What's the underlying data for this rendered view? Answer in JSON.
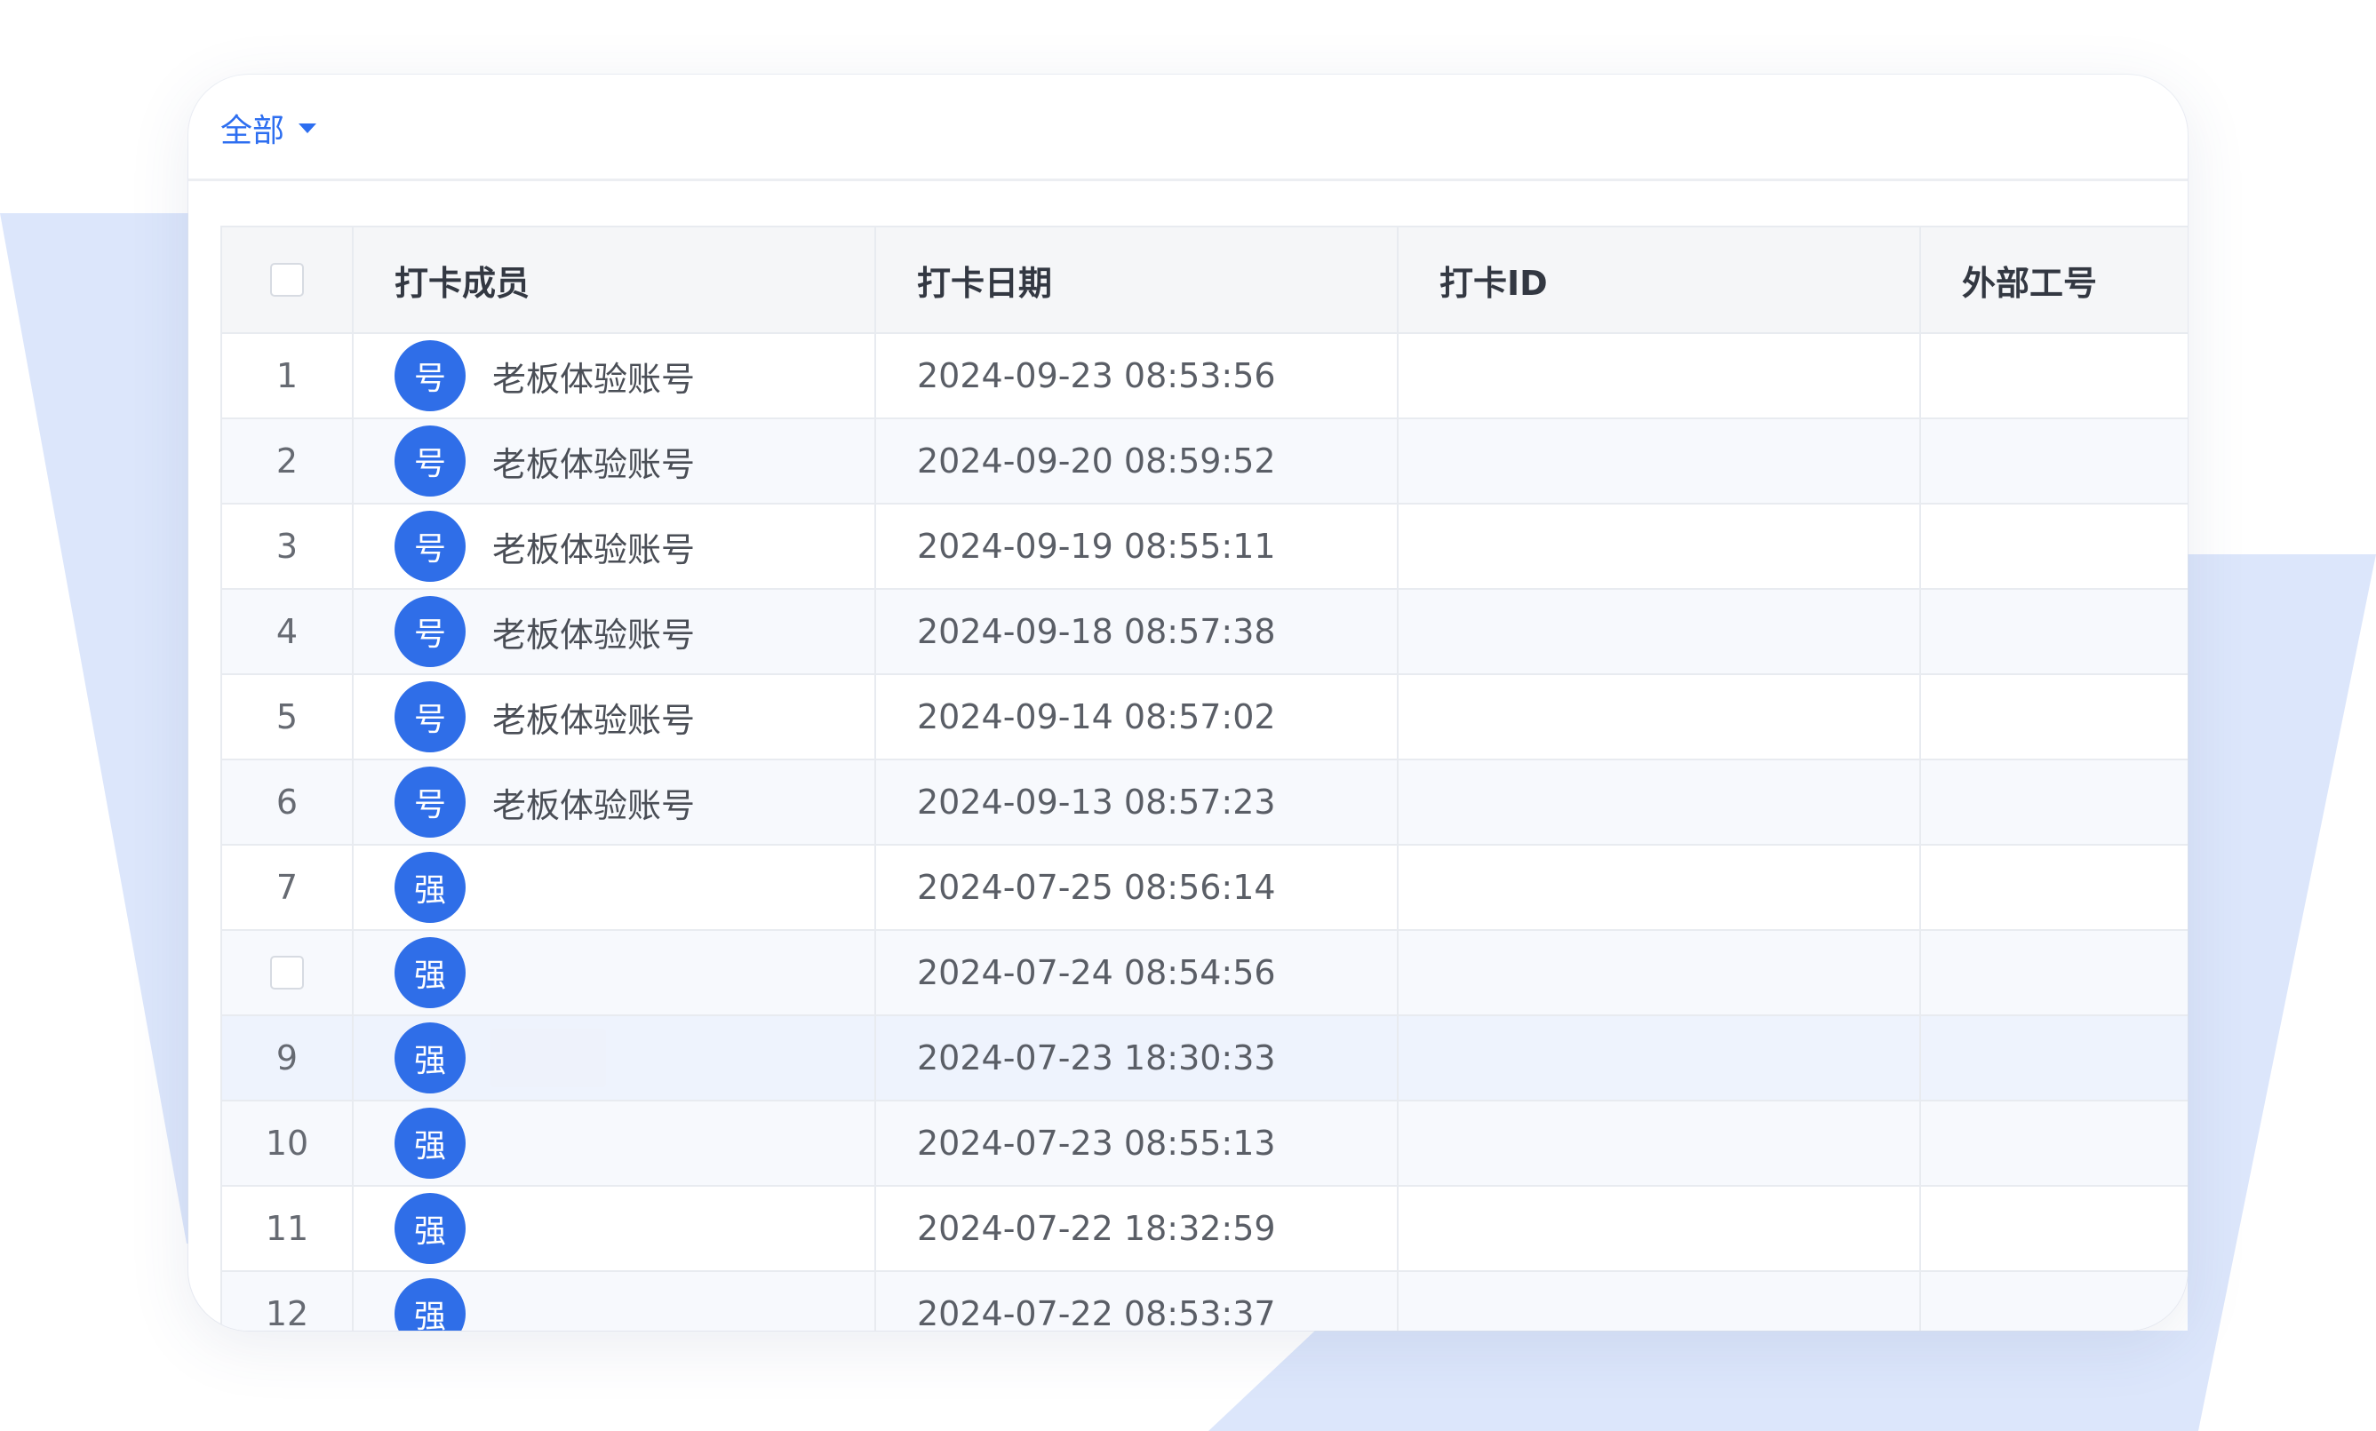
{
  "filter": {
    "label": "全部"
  },
  "table": {
    "columns": [
      {
        "label": "打卡成员"
      },
      {
        "label": "打卡日期"
      },
      {
        "label": "打卡ID"
      },
      {
        "label": "外部工号"
      }
    ],
    "rows": [
      {
        "index": "1",
        "avatar": "号",
        "member": "老板体验账号",
        "date": "2024-09-23 08:53:56",
        "checkin_id": "",
        "employee_no": ""
      },
      {
        "index": "2",
        "avatar": "号",
        "member": "老板体验账号",
        "date": "2024-09-20 08:59:52",
        "checkin_id": "",
        "employee_no": ""
      },
      {
        "index": "3",
        "avatar": "号",
        "member": "老板体验账号",
        "date": "2024-09-19 08:55:11",
        "checkin_id": "",
        "employee_no": ""
      },
      {
        "index": "4",
        "avatar": "号",
        "member": "老板体验账号",
        "date": "2024-09-18 08:57:38",
        "checkin_id": "",
        "employee_no": ""
      },
      {
        "index": "5",
        "avatar": "号",
        "member": "老板体验账号",
        "date": "2024-09-14 08:57:02",
        "checkin_id": "",
        "employee_no": ""
      },
      {
        "index": "6",
        "avatar": "号",
        "member": "老板体验账号",
        "date": "2024-09-13 08:57:23",
        "checkin_id": "",
        "employee_no": ""
      },
      {
        "index": "7",
        "avatar": "强",
        "member": "",
        "date": "2024-07-25 08:56:14",
        "checkin_id": "",
        "employee_no": ""
      },
      {
        "index": "",
        "avatar": "强",
        "member": "",
        "date": "2024-07-24 08:54:56",
        "checkin_id": "",
        "employee_no": ""
      },
      {
        "index": "9",
        "avatar": "强",
        "member": "",
        "date": "2024-07-23 18:30:33",
        "checkin_id": "",
        "employee_no": ""
      },
      {
        "index": "10",
        "avatar": "强",
        "member": "",
        "date": "2024-07-23 08:55:13",
        "checkin_id": "",
        "employee_no": ""
      },
      {
        "index": "11",
        "avatar": "强",
        "member": "",
        "date": "2024-07-22 18:32:59",
        "checkin_id": "",
        "employee_no": ""
      },
      {
        "index": "12",
        "avatar": "强",
        "member": "",
        "date": "2024-07-22 08:53:37",
        "checkin_id": "",
        "employee_no": ""
      }
    ]
  },
  "colors": {
    "accent": "#2d6ef0",
    "avatar_bg": "#2f6ee8",
    "decor_shape": "#dce6fb"
  }
}
